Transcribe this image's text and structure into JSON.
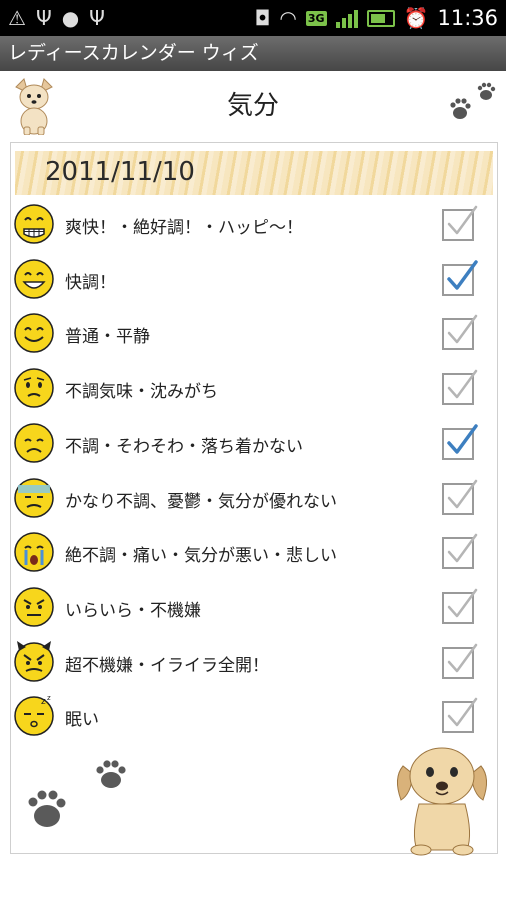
{
  "status_bar": {
    "time": "11:36",
    "network": "3G",
    "icons": [
      "warning-icon",
      "usb-icon",
      "android-icon",
      "usb-debug-icon",
      "voicemail-icon",
      "headset-icon",
      "network-3g-icon",
      "signal-icon",
      "battery-icon",
      "alarm-icon"
    ]
  },
  "app": {
    "title": "レディースカレンダー ウィズ"
  },
  "header": {
    "title": "気分"
  },
  "date": "2011/11/10",
  "moods": [
    {
      "label": "爽快！・絶好調！・ハッピ〜！",
      "face": "grin-teeth-icon",
      "checked": false
    },
    {
      "label": "快調！",
      "face": "big-smile-icon",
      "checked": true
    },
    {
      "label": "普通・平静",
      "face": "smile-icon",
      "checked": false
    },
    {
      "label": "不調気味・沈みがち",
      "face": "worried-icon",
      "checked": false
    },
    {
      "label": "不調・そわそわ・落ち着かない",
      "face": "sad-icon",
      "checked": true
    },
    {
      "label": "かなり不調、憂鬱・気分が優れない",
      "face": "depressed-icon",
      "checked": false
    },
    {
      "label": "絶不調・痛い・気分が悪い・悲しい",
      "face": "crying-icon",
      "checked": false
    },
    {
      "label": "いらいら・不機嫌",
      "face": "annoyed-icon",
      "checked": false
    },
    {
      "label": "超不機嫌・イライラ全開！",
      "face": "angry-devil-icon",
      "checked": false
    },
    {
      "label": "眠い",
      "face": "sleepy-icon",
      "checked": false
    }
  ],
  "colors": {
    "face_yellow": "#f7d61c",
    "check_blue": "#3d7fc0",
    "title_bar": "#555555"
  }
}
